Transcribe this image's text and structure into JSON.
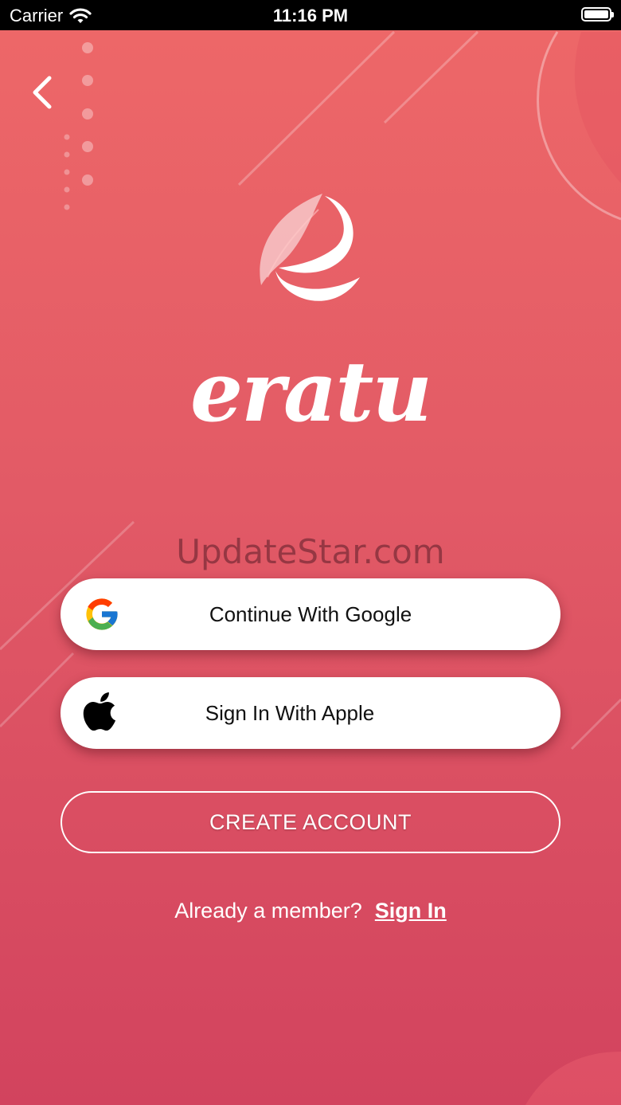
{
  "status_bar": {
    "carrier": "Carrier",
    "time": "11:16 PM"
  },
  "brand": {
    "wordmark": "eratu"
  },
  "watermark": "UpdateStar.com",
  "buttons": {
    "google": "Continue With Google",
    "apple": "Sign In With Apple",
    "create_account": "CREATE ACCOUNT"
  },
  "footer": {
    "prompt": "Already a member?",
    "sign_in": "Sign In"
  },
  "icons": {
    "back": "chevron-left-icon",
    "google": "google-logo-icon",
    "apple": "apple-logo-icon",
    "wifi": "wifi-icon",
    "battery": "battery-icon"
  },
  "colors": {
    "gradient_top": "#ee6868",
    "gradient_bottom": "#d2435e"
  }
}
